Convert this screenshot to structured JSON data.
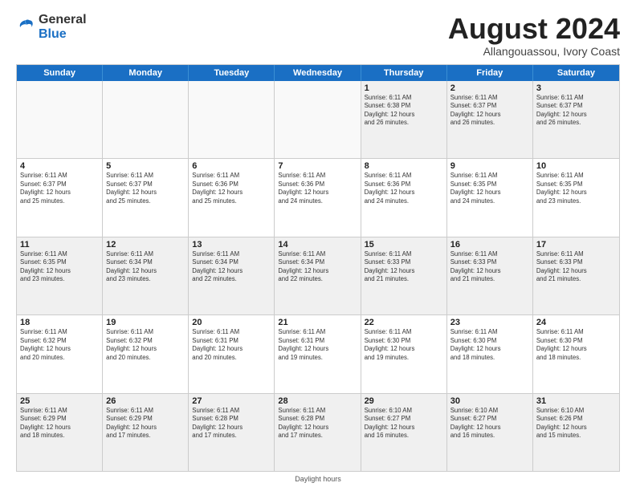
{
  "header": {
    "logo_general": "General",
    "logo_blue": "Blue",
    "month_title": "August 2024",
    "location": "Allangouassou, Ivory Coast"
  },
  "footer": {
    "note": "Daylight hours"
  },
  "days_of_week": [
    "Sunday",
    "Monday",
    "Tuesday",
    "Wednesday",
    "Thursday",
    "Friday",
    "Saturday"
  ],
  "weeks": [
    [
      {
        "day": "",
        "info": "",
        "empty": true
      },
      {
        "day": "",
        "info": "",
        "empty": true
      },
      {
        "day": "",
        "info": "",
        "empty": true
      },
      {
        "day": "",
        "info": "",
        "empty": true
      },
      {
        "day": "1",
        "info": "Sunrise: 6:11 AM\nSunset: 6:38 PM\nDaylight: 12 hours\nand 26 minutes."
      },
      {
        "day": "2",
        "info": "Sunrise: 6:11 AM\nSunset: 6:37 PM\nDaylight: 12 hours\nand 26 minutes."
      },
      {
        "day": "3",
        "info": "Sunrise: 6:11 AM\nSunset: 6:37 PM\nDaylight: 12 hours\nand 26 minutes."
      }
    ],
    [
      {
        "day": "4",
        "info": "Sunrise: 6:11 AM\nSunset: 6:37 PM\nDaylight: 12 hours\nand 25 minutes."
      },
      {
        "day": "5",
        "info": "Sunrise: 6:11 AM\nSunset: 6:37 PM\nDaylight: 12 hours\nand 25 minutes."
      },
      {
        "day": "6",
        "info": "Sunrise: 6:11 AM\nSunset: 6:36 PM\nDaylight: 12 hours\nand 25 minutes."
      },
      {
        "day": "7",
        "info": "Sunrise: 6:11 AM\nSunset: 6:36 PM\nDaylight: 12 hours\nand 24 minutes."
      },
      {
        "day": "8",
        "info": "Sunrise: 6:11 AM\nSunset: 6:36 PM\nDaylight: 12 hours\nand 24 minutes."
      },
      {
        "day": "9",
        "info": "Sunrise: 6:11 AM\nSunset: 6:35 PM\nDaylight: 12 hours\nand 24 minutes."
      },
      {
        "day": "10",
        "info": "Sunrise: 6:11 AM\nSunset: 6:35 PM\nDaylight: 12 hours\nand 23 minutes."
      }
    ],
    [
      {
        "day": "11",
        "info": "Sunrise: 6:11 AM\nSunset: 6:35 PM\nDaylight: 12 hours\nand 23 minutes."
      },
      {
        "day": "12",
        "info": "Sunrise: 6:11 AM\nSunset: 6:34 PM\nDaylight: 12 hours\nand 23 minutes."
      },
      {
        "day": "13",
        "info": "Sunrise: 6:11 AM\nSunset: 6:34 PM\nDaylight: 12 hours\nand 22 minutes."
      },
      {
        "day": "14",
        "info": "Sunrise: 6:11 AM\nSunset: 6:34 PM\nDaylight: 12 hours\nand 22 minutes."
      },
      {
        "day": "15",
        "info": "Sunrise: 6:11 AM\nSunset: 6:33 PM\nDaylight: 12 hours\nand 21 minutes."
      },
      {
        "day": "16",
        "info": "Sunrise: 6:11 AM\nSunset: 6:33 PM\nDaylight: 12 hours\nand 21 minutes."
      },
      {
        "day": "17",
        "info": "Sunrise: 6:11 AM\nSunset: 6:33 PM\nDaylight: 12 hours\nand 21 minutes."
      }
    ],
    [
      {
        "day": "18",
        "info": "Sunrise: 6:11 AM\nSunset: 6:32 PM\nDaylight: 12 hours\nand 20 minutes."
      },
      {
        "day": "19",
        "info": "Sunrise: 6:11 AM\nSunset: 6:32 PM\nDaylight: 12 hours\nand 20 minutes."
      },
      {
        "day": "20",
        "info": "Sunrise: 6:11 AM\nSunset: 6:31 PM\nDaylight: 12 hours\nand 20 minutes."
      },
      {
        "day": "21",
        "info": "Sunrise: 6:11 AM\nSunset: 6:31 PM\nDaylight: 12 hours\nand 19 minutes."
      },
      {
        "day": "22",
        "info": "Sunrise: 6:11 AM\nSunset: 6:30 PM\nDaylight: 12 hours\nand 19 minutes."
      },
      {
        "day": "23",
        "info": "Sunrise: 6:11 AM\nSunset: 6:30 PM\nDaylight: 12 hours\nand 18 minutes."
      },
      {
        "day": "24",
        "info": "Sunrise: 6:11 AM\nSunset: 6:30 PM\nDaylight: 12 hours\nand 18 minutes."
      }
    ],
    [
      {
        "day": "25",
        "info": "Sunrise: 6:11 AM\nSunset: 6:29 PM\nDaylight: 12 hours\nand 18 minutes."
      },
      {
        "day": "26",
        "info": "Sunrise: 6:11 AM\nSunset: 6:29 PM\nDaylight: 12 hours\nand 17 minutes."
      },
      {
        "day": "27",
        "info": "Sunrise: 6:11 AM\nSunset: 6:28 PM\nDaylight: 12 hours\nand 17 minutes."
      },
      {
        "day": "28",
        "info": "Sunrise: 6:11 AM\nSunset: 6:28 PM\nDaylight: 12 hours\nand 17 minutes."
      },
      {
        "day": "29",
        "info": "Sunrise: 6:10 AM\nSunset: 6:27 PM\nDaylight: 12 hours\nand 16 minutes."
      },
      {
        "day": "30",
        "info": "Sunrise: 6:10 AM\nSunset: 6:27 PM\nDaylight: 12 hours\nand 16 minutes."
      },
      {
        "day": "31",
        "info": "Sunrise: 6:10 AM\nSunset: 6:26 PM\nDaylight: 12 hours\nand 15 minutes."
      }
    ]
  ]
}
